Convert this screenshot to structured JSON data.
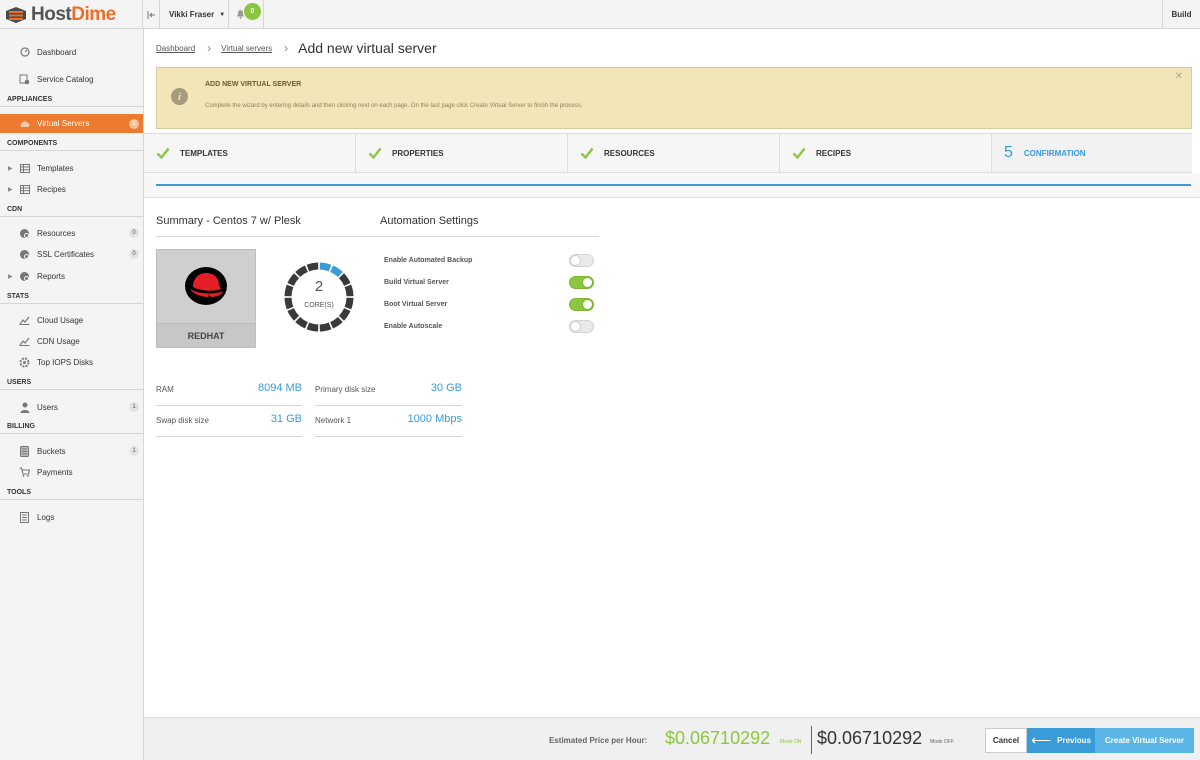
{
  "brand": {
    "name_part1": "Host",
    "name_part2": "Dime"
  },
  "topbar": {
    "user_name": "Vikki Fraser",
    "notification_count": "0",
    "build_label": "Build"
  },
  "sidebar": {
    "dashboard": "Dashboard",
    "service_catalog": "Service Catalog",
    "sections": {
      "appliances": "APPLIANCES",
      "components": "COMPONENTS",
      "cdn": "CDN",
      "stats": "STATS",
      "users": "USERS",
      "billing": "BILLING",
      "tools": "TOOLS"
    },
    "virtual_servers": {
      "label": "Virtual Servers",
      "count": "1"
    },
    "templates": "Templates",
    "recipes": "Recipes",
    "resources": {
      "label": "Resources",
      "count": "0"
    },
    "ssl_certificates": {
      "label": "SSL Certificates",
      "count": "0"
    },
    "reports": "Reports",
    "cloud_usage": "Cloud Usage",
    "cdn_usage": "CDN Usage",
    "top_iops_disks": "Top IOPS Disks",
    "users_item": {
      "label": "Users",
      "count": "1"
    },
    "buckets": {
      "label": "Buckets",
      "count": "1"
    },
    "payments": "Payments",
    "logs": "Logs"
  },
  "breadcrumb": {
    "dashboard": "Dashboard",
    "virtual_servers": "Virtual servers",
    "current": "Add new virtual server"
  },
  "alert": {
    "title": "ADD NEW VIRTUAL SERVER",
    "text": "Complete the wizard by entering details and then clicking next on each page. On the last page click Create Virtual Server to finish the process."
  },
  "steps": [
    {
      "label": "TEMPLATES",
      "done": true
    },
    {
      "label": "PROPERTIES",
      "done": true
    },
    {
      "label": "RESOURCES",
      "done": true
    },
    {
      "label": "RECIPES",
      "done": true
    },
    {
      "label": "CONFIRMATION",
      "number": "5",
      "current": true
    }
  ],
  "summary": {
    "title": "Summary - Centos 7 w/ Plesk",
    "os_name": "REDHAT",
    "cores_value": "2",
    "cores_label": "CORE(S)",
    "cores_fraction": 0.125,
    "specs": {
      "ram_label": "RAM",
      "ram_value": "8094 MB",
      "swap_label": "Swap disk size",
      "swap_value": "31 GB",
      "primary_label": "Primary disk size",
      "primary_value": "30 GB",
      "network_label": "Network 1",
      "network_value": "1000 Mbps"
    }
  },
  "automation": {
    "title": "Automation Settings",
    "settings": [
      {
        "label": "Enable Automated Backup",
        "on": false
      },
      {
        "label": "Build Virtual Server",
        "on": true
      },
      {
        "label": "Boot Virtual Server",
        "on": true
      },
      {
        "label": "Enable Autoscale",
        "on": false
      }
    ]
  },
  "footer": {
    "estimated_label": "Estimated Price per Hour:",
    "price_on": "$0.06710292",
    "mode_on": "Mode ON",
    "price_off": "$0.06710292",
    "mode_off": "Mode OFF",
    "cancel": "Cancel",
    "previous": "Previous",
    "create": "Create Virtual Server"
  },
  "colors": {
    "accent": "#3a9bd9",
    "brand_orange": "#ec7a2f",
    "success_green": "#8cc63f",
    "alert_bg": "#f2e6b8"
  }
}
